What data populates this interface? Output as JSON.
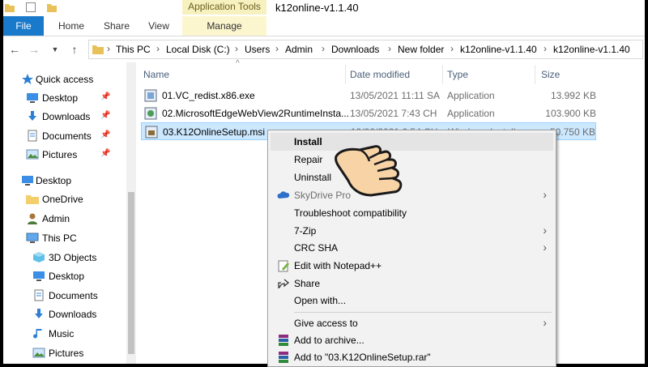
{
  "window": {
    "title": "k12online-v1.1.40",
    "contextual_tab_header": "Application Tools"
  },
  "ribbon": {
    "tabs": [
      "File",
      "Home",
      "Share",
      "View",
      "Manage"
    ]
  },
  "address": {
    "crumbs": [
      "This PC",
      "Local Disk (C:)",
      "Users",
      "Admin",
      "Downloads",
      "New folder",
      "k12online-v1.1.40",
      "k12online-v1.1.40"
    ]
  },
  "nav": {
    "items": [
      {
        "label": "Quick access",
        "icon": "star-icon",
        "pinned": false
      },
      {
        "label": "Desktop",
        "icon": "desktop-icon",
        "pinned": true
      },
      {
        "label": "Downloads",
        "icon": "download-icon",
        "pinned": true
      },
      {
        "label": "Documents",
        "icon": "documents-icon",
        "pinned": true
      },
      {
        "label": "Pictures",
        "icon": "pictures-icon",
        "pinned": true
      },
      {
        "label": "Desktop",
        "icon": "desktop-icon",
        "pinned": false
      },
      {
        "label": "OneDrive",
        "icon": "folder-icon",
        "pinned": false
      },
      {
        "label": "Admin",
        "icon": "user-icon",
        "pinned": false
      },
      {
        "label": "This PC",
        "icon": "computer-icon",
        "pinned": false
      },
      {
        "label": "3D Objects",
        "icon": "cube-icon",
        "pinned": false
      },
      {
        "label": "Desktop",
        "icon": "desktop-icon",
        "pinned": false
      },
      {
        "label": "Documents",
        "icon": "documents-icon",
        "pinned": false
      },
      {
        "label": "Downloads",
        "icon": "download-icon",
        "pinned": false
      },
      {
        "label": "Music",
        "icon": "music-icon",
        "pinned": false
      },
      {
        "label": "Pictures",
        "icon": "pictures-icon",
        "pinned": false
      }
    ]
  },
  "columns": {
    "name": "Name",
    "date": "Date modified",
    "type": "Type",
    "size": "Size"
  },
  "files": [
    {
      "name": "01.VC_redist.x86.exe",
      "date": "13/05/2021 11:11 SA",
      "type": "Application",
      "size": "13.992 KB"
    },
    {
      "name": "02.MicrosoftEdgeWebView2RuntimeInsta...",
      "date": "13/05/2021 7:43 CH",
      "type": "Application",
      "size": "103.900 KB"
    },
    {
      "name": "03.K12OnlineSetup.msi",
      "date": "19/06/2021 6:54 CH",
      "type": "Windows Install...",
      "size": "50.750 KB"
    }
  ],
  "context_menu": {
    "items": [
      {
        "label": "Install",
        "icon": "",
        "submenu": false
      },
      {
        "label": "Repair",
        "icon": "",
        "submenu": false
      },
      {
        "label": "Uninstall",
        "icon": "",
        "submenu": false
      },
      {
        "label": "SkyDrive Pro",
        "icon": "cloud-icon",
        "submenu": true
      },
      {
        "label": "Troubleshoot compatibility",
        "icon": "",
        "submenu": false
      },
      {
        "label": "7-Zip",
        "icon": "",
        "submenu": true
      },
      {
        "label": "CRC SHA",
        "icon": "",
        "submenu": true
      },
      {
        "label": "Edit with Notepad++",
        "icon": "notepad-icon",
        "submenu": false
      },
      {
        "label": "Share",
        "icon": "share-icon",
        "submenu": false
      },
      {
        "label": "Open with...",
        "icon": "",
        "submenu": false
      },
      {
        "label": "Give access to",
        "icon": "",
        "submenu": true
      },
      {
        "label": "Add to archive...",
        "icon": "winrar-icon",
        "submenu": false
      },
      {
        "label": "Add to \"03.K12OnlineSetup.rar\"",
        "icon": "winrar-icon",
        "submenu": false
      }
    ]
  },
  "colors": {
    "file_tab": "#1979ca",
    "selection": "#cce8ff",
    "app_tools": "#f7f1bf"
  }
}
